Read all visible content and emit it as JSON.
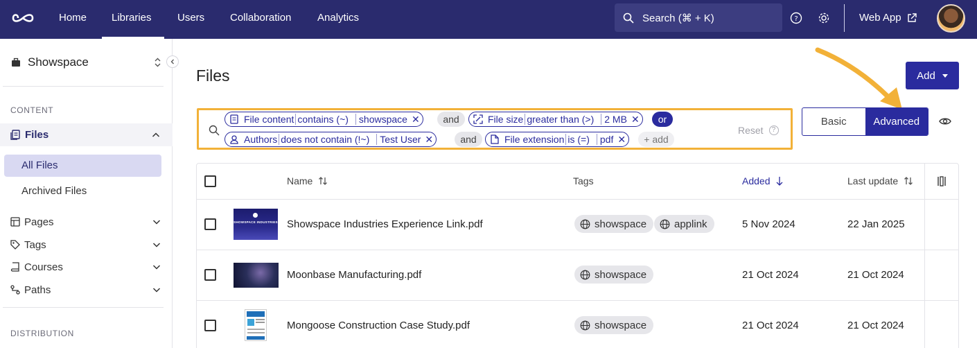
{
  "nav": {
    "items": [
      "Home",
      "Libraries",
      "Users",
      "Collaboration",
      "Analytics"
    ],
    "active": "Libraries",
    "search_placeholder": "Search (⌘ + K)",
    "web_app": "Web App"
  },
  "sidebar": {
    "workspace": "Showspace",
    "content_label": "CONTENT",
    "files_label": "Files",
    "files_sub": [
      "All Files",
      "Archived Files"
    ],
    "groups": [
      "Pages",
      "Tags",
      "Courses",
      "Paths"
    ],
    "distribution_label": "DISTRIBUTION"
  },
  "main": {
    "title": "Files",
    "add_label": "Add",
    "filters": {
      "f1": {
        "field": "File content",
        "op": "contains (~)",
        "value": "showspace"
      },
      "c1": "and",
      "f2": {
        "field": "File size",
        "op": "greater than (>)",
        "value": "2 MB"
      },
      "c2": "or",
      "f3": {
        "field": "Authors",
        "op": "does not contain (!~)",
        "value": "Test User"
      },
      "c3": "and",
      "f4": {
        "field": "File extension",
        "op": "is (=)",
        "value": "pdf"
      },
      "add": "+ add",
      "reset": "Reset"
    },
    "mode": {
      "basic": "Basic",
      "advanced": "Advanced",
      "selected": "Advanced"
    },
    "table": {
      "headers": {
        "name": "Name",
        "tags": "Tags",
        "added": "Added",
        "updated": "Last update"
      },
      "rows": [
        {
          "name": "Showspace Industries Experience Link.pdf",
          "tags": [
            "showspace",
            "applink"
          ],
          "added": "5 Nov 2024",
          "updated": "22 Jan 2025",
          "thumb_text": "SHOWSPACE INDUSTRIES"
        },
        {
          "name": "Moonbase Manufacturing.pdf",
          "tags": [
            "showspace"
          ],
          "added": "21 Oct 2024",
          "updated": "21 Oct 2024"
        },
        {
          "name": "Mongoose Construction Case Study.pdf",
          "tags": [
            "showspace"
          ],
          "added": "21 Oct 2024",
          "updated": "21 Oct 2024"
        }
      ]
    }
  },
  "colors": {
    "nav_bg": "#2a2b6e",
    "accent": "#2a2b9e",
    "highlight": "#f2b138"
  }
}
